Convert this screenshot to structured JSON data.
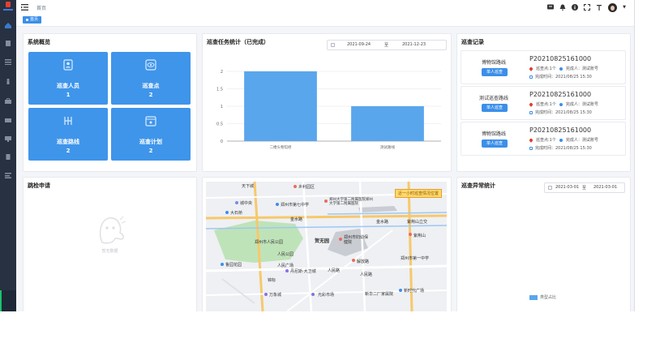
{
  "topbar": {
    "breadcrumb": "首页"
  },
  "tabs": [
    {
      "label": "首页"
    }
  ],
  "overview": {
    "title": "系统概览",
    "tiles": [
      {
        "label": "巡查人员",
        "value": "1",
        "icon": "person-badge-icon"
      },
      {
        "label": "巡查点",
        "value": "2",
        "icon": "eye-icon"
      },
      {
        "label": "巡查路线",
        "value": "2",
        "icon": "route-icon"
      },
      {
        "label": "巡查计划",
        "value": "2",
        "icon": "calendar-icon"
      }
    ]
  },
  "task_chart": {
    "title": "巡查任务统计（已完成）",
    "date_start": "2021-09-24",
    "date_sep": "至",
    "date_end": "2021-12-23"
  },
  "chart_data": {
    "type": "bar",
    "categories": [
      "二楼头物馆修",
      "测试路线"
    ],
    "values": [
      2,
      1
    ],
    "ylim": [
      0,
      2
    ],
    "yticks": [
      "0",
      "0.5",
      "1",
      "1.5",
      "2"
    ],
    "bar_color": "#5aa6ec"
  },
  "records": {
    "title": "巡查记录",
    "items": [
      {
        "name": "博物馆路线",
        "button": "单人巡查",
        "code": "P20210825161000",
        "points": "巡查点:1个",
        "person": "完成人：测试账号",
        "time": "完成时间：2021/08/25 15:30"
      },
      {
        "name": "测试巡查路线",
        "button": "单人巡查",
        "code": "P20210825161000",
        "points": "巡查点:1个",
        "person": "完成人：测试账号",
        "time": "完成时间：2021/08/25 15:30"
      },
      {
        "name": "博物馆路线",
        "button": "单人巡查",
        "code": "P20210825161000",
        "points": "巡查点:1个",
        "person": "完成人：测试账号",
        "time": "完成时间：2021/08/25 15:30"
      }
    ]
  },
  "inspection": {
    "title": "跳检申请",
    "empty_text": "暂无数据"
  },
  "map": {
    "labels": [
      "天下城",
      "乡利园区",
      "城中央",
      "郑州市第七中学",
      "郑州大学第二附属医院郑州大学第二附属医院",
      "近一小时巡查情况位置",
      "大石桥",
      "金水路",
      "金水路",
      "紫荆山立交",
      "紫荆山",
      "郑州市人民公园",
      "贺无园",
      "郑州市妇幼保健院",
      "人民公园",
      "鲁园花园",
      "解放路",
      "人民广场",
      "丹尼斯·大卫城",
      "人民路",
      "锦标",
      "万象城",
      "光彩市场",
      "新华二厂家属院",
      "人民路",
      "郑州市第一中学",
      "新时代广场"
    ]
  },
  "abnormal": {
    "title": "巡查异常统计",
    "date_start": "2021-03-01",
    "date_sep": "至",
    "date_end": "2021-03-01",
    "legend": "类型占比"
  },
  "colors": {
    "accent": "#3b8fe9",
    "tile": "#3f95ea",
    "sidebar": "#273142"
  }
}
